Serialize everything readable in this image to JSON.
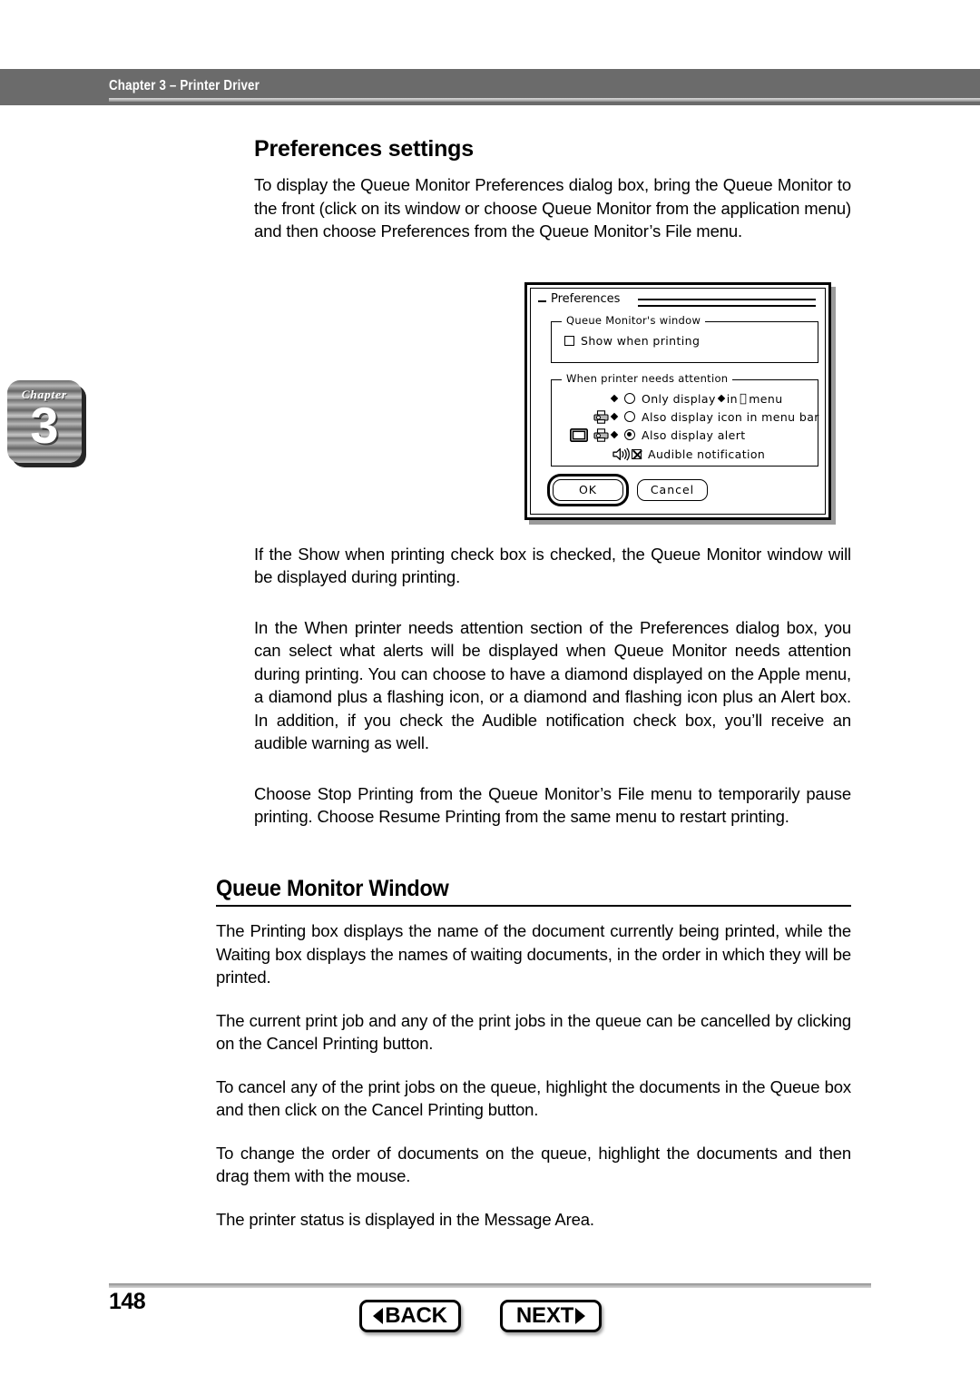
{
  "header": {
    "running_title": "Chapter 3 – Printer Driver"
  },
  "chapter_tab": {
    "word": "Chapter",
    "number": "3"
  },
  "main": {
    "section_title": "Preferences settings",
    "intro_paragraph": "To display the Queue Monitor Preferences dialog box, bring the Queue Monitor to the front (click on its window or choose Queue Monitor from the application menu) and then choose Preferences from the Queue Monitor’s File menu.",
    "paragraph_show_when_printing": "If the Show when printing check box is checked, the Queue Monitor window will be displayed during printing.",
    "paragraph_attention": "In the When printer needs attention section of the Preferences dialog box, you can select what alerts will be displayed when Queue Monitor needs attention during printing.  You can choose to have a diamond displayed on the Apple menu, a diamond plus a flashing icon, or a diamond and flashing icon plus an Alert box.  In addition, if you check the Audible notification check box, you’ll receive an audible warning as well.",
    "paragraph_stop_printing": "Choose Stop Printing from the Queue Monitor’s File menu to temporarily pause printing.  Choose Resume Printing from the same menu to restart printing.",
    "section_title_2": "Queue Monitor Window",
    "paragraph_printing_box": "The Printing box displays the name of the document currently being printed, while the Waiting box displays the names of waiting documents, in the order in which they will be printed.",
    "paragraph_cancel_jobs": "The current print job and any of the print jobs in the queue can be cancelled by clicking on the Cancel Printing button.",
    "paragraph_cancel_queue": "To cancel any of the print jobs on the queue, highlight the documents in the Queue box and then click on the Cancel Printing button.",
    "paragraph_reorder": "To change the order of documents on the queue, highlight the documents and then drag them with the mouse.",
    "paragraph_status": "The printer status is displayed in the Message Area."
  },
  "dialog": {
    "title": "Preferences",
    "close_box_icon": "collapse-box-icon",
    "group_window": {
      "label": "Queue Monitor's window",
      "checkbox": {
        "label": "Show when printing",
        "checked": false
      }
    },
    "group_attention": {
      "label": "When printer needs attention",
      "options": [
        {
          "label_before_apple": "Only display",
          "label_after_apple": "in",
          "label_tail": "menu",
          "selected": false,
          "icons": [
            "diamond-icon"
          ],
          "apple_icon": "apple-logo-icon"
        },
        {
          "label": "Also display icon in menu bar",
          "selected": false,
          "icons": [
            "printer-icon",
            "diamond-icon"
          ]
        },
        {
          "label": "Also display alert",
          "selected": true,
          "icons": [
            "monitor-icon",
            "printer-icon",
            "diamond-icon"
          ]
        }
      ],
      "audible": {
        "label": "Audible notification",
        "checked": true,
        "icon": "speaker-icon"
      }
    },
    "buttons": {
      "ok": "OK",
      "cancel": "Cancel"
    }
  },
  "footer": {
    "page_number": "148",
    "back_label": "BACK",
    "next_label": "NEXT"
  }
}
